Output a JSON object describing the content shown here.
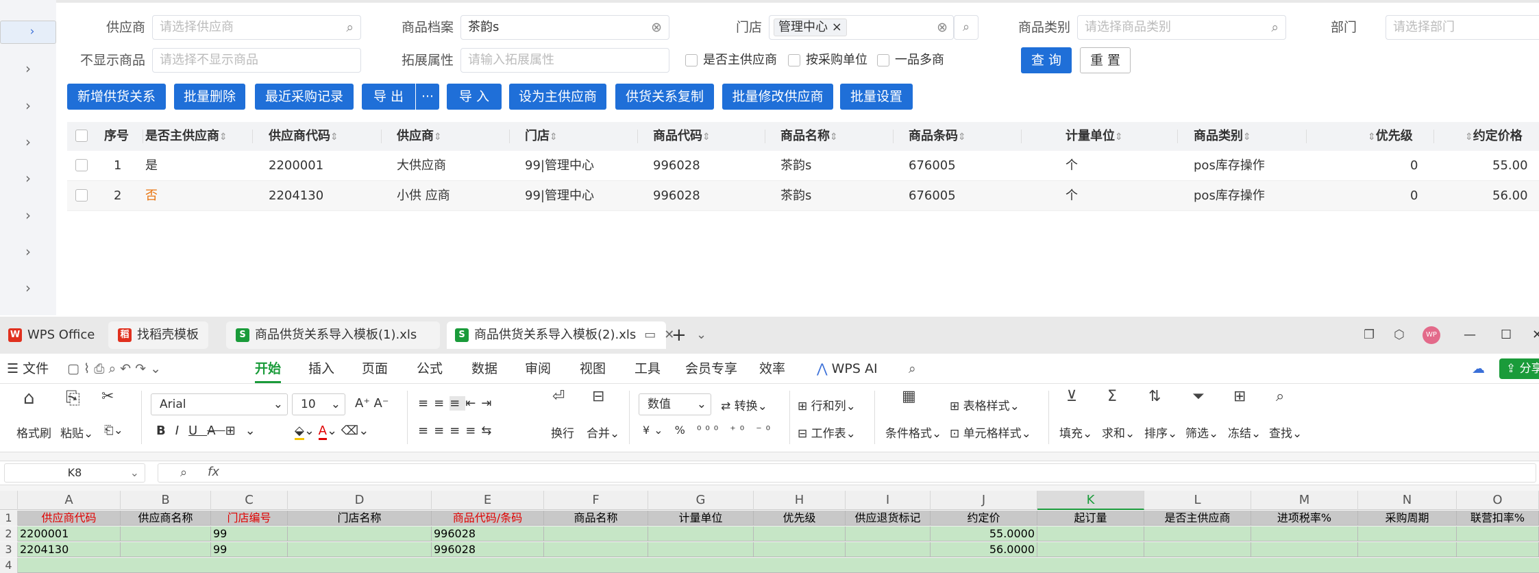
{
  "filters": {
    "supplier_label": "供应商",
    "supplier_placeholder": "请选择供应商",
    "product_label": "商品档案",
    "product_value": "茶韵s",
    "store_label": "门店",
    "store_tag": "管理中心",
    "category_label": "商品类别",
    "category_placeholder": "请选择商品类别",
    "dept_label": "部门",
    "dept_placeholder": "请选择部门",
    "hide_label": "不显示商品",
    "hide_placeholder": "请选择不显示商品",
    "ext_label": "拓展属性",
    "ext_placeholder": "请输入拓展属性",
    "chk_main": "是否主供应商",
    "chk_unit": "按采购单位",
    "chk_multi": "一品多商",
    "query": "查 询",
    "reset": "重 置"
  },
  "actions": {
    "add": "新增供货关系",
    "batch_delete": "批量删除",
    "recent": "最近采购记录",
    "export": "导 出",
    "more": "···",
    "import": "导 入",
    "set_main": "设为主供应商",
    "copy": "供货关系复制",
    "batch_modify": "批量修改供应商",
    "batch_set": "批量设置"
  },
  "table": {
    "headers": [
      "序号",
      "是否主供应商",
      "供应商代码",
      "供应商",
      "门店",
      "商品代码",
      "商品名称",
      "商品条码",
      "计量单位",
      "商品类别",
      "优先级",
      "约定价格"
    ],
    "rows": [
      [
        "1",
        "是",
        "2200001",
        "大供应商",
        "99|管理中心",
        "996028",
        "茶韵s",
        "676005",
        "个",
        "pos库存操作",
        "0",
        "55.00"
      ],
      [
        "2",
        "否",
        "2204130",
        "小供 应商",
        "99|管理中心",
        "996028",
        "茶韵s",
        "676005",
        "个",
        "pos库存操作",
        "0",
        "56.00"
      ]
    ]
  },
  "wps": {
    "tabs": [
      "WPS Office",
      "找稻壳模板",
      "商品供货关系导入模板(1).xls",
      "商品供货关系导入模板(2).xls"
    ],
    "menu": [
      "文件",
      "开始",
      "插入",
      "页面",
      "公式",
      "数据",
      "审阅",
      "视图",
      "工具",
      "会员专享",
      "效率",
      "WPS AI"
    ],
    "ribbon": {
      "format_painter": "格式刷",
      "paste": "粘贴",
      "font": "Arial",
      "size": "10",
      "wrap": "换行",
      "merge": "合并",
      "numfmt": "数值",
      "convert": "转换",
      "rowcol": "行和列",
      "sheet": "工作表",
      "cond": "条件格式",
      "tstyle": "表格样式",
      "cellstyle": "单元格样式",
      "fill": "填充",
      "sum": "求和",
      "sort": "排序",
      "filter": "筛选",
      "freeze": "冻结",
      "find": "查找",
      "share": "分享"
    },
    "cellref": "K8",
    "fx": "fx",
    "columns": [
      "A",
      "B",
      "C",
      "D",
      "E",
      "F",
      "G",
      "H",
      "I",
      "J",
      "K",
      "L",
      "M",
      "N",
      "O"
    ],
    "row_numbers": [
      "1",
      "2",
      "3",
      "4"
    ],
    "header_row": [
      "供应商代码",
      "供应商名称",
      "门店编号",
      "门店名称",
      "商品代码/条码",
      "商品名称",
      "计量单位",
      "优先级",
      "供应退货标记",
      "约定价",
      "起订量",
      "是否主供应商",
      "进项税率%",
      "采购周期",
      "联营扣率%"
    ],
    "data_rows": [
      [
        "2200001",
        "",
        "99",
        "",
        "996028",
        "",
        "",
        "",
        "",
        "55.0000",
        "",
        "",
        "",
        "",
        ""
      ],
      [
        "2204130",
        "",
        "99",
        "",
        "996028",
        "",
        "",
        "",
        "",
        "56.0000",
        "",
        "",
        "",
        "",
        ""
      ]
    ]
  }
}
